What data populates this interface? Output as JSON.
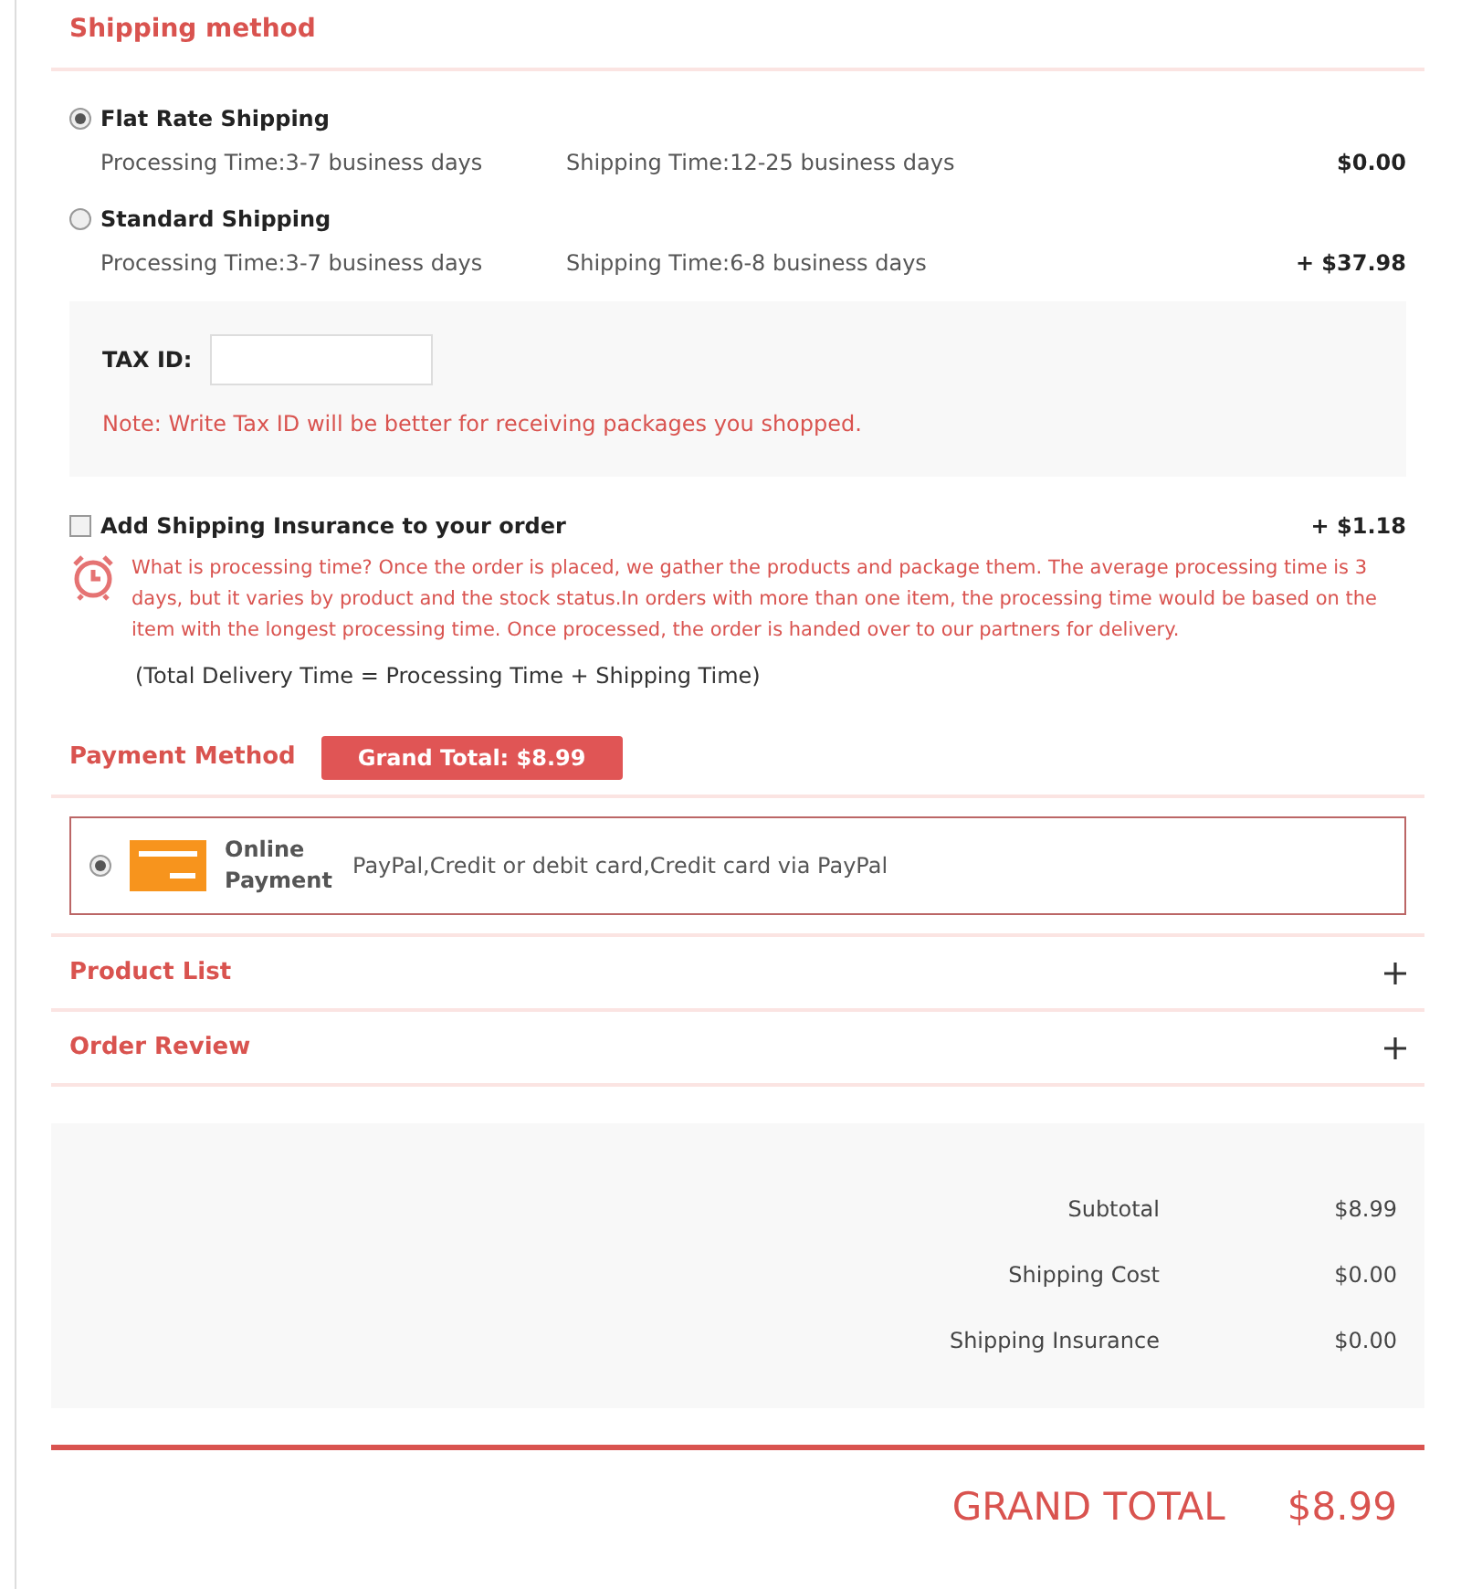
{
  "shipping": {
    "title": "Shipping method",
    "options": [
      {
        "name": "Flat Rate Shipping",
        "selected": true,
        "processing": "Processing Time:3-7 business days",
        "shipping_time": "Shipping Time:12-25 business days",
        "price": "$0.00"
      },
      {
        "name": "Standard Shipping",
        "selected": false,
        "processing": "Processing Time:3-7 business days",
        "shipping_time": "Shipping Time:6-8 business days",
        "price": "+ $37.98"
      }
    ],
    "tax": {
      "label": "TAX ID:",
      "note": "Note: Write Tax ID will be better for receiving packages you shopped."
    },
    "insurance": {
      "label": "Add Shipping Insurance to your order",
      "checked": false,
      "price": "+ $1.18"
    },
    "info": "What is processing time? Once the order is placed, we gather the products and package them. The average processing time is 3 days, but it varies by product and the stock status.In orders with more than one item, the processing time would be based on the item with the longest processing time. Once processed, the order is handed over to our partners for delivery.",
    "formula": "(Total Delivery Time = Processing Time + Shipping Time)"
  },
  "payment": {
    "title": "Payment Method",
    "badge": "Grand Total: $8.99",
    "methods": [
      {
        "name": "Online Payment",
        "selected": true,
        "description": "PayPal,Credit or debit card,Credit card via PayPal"
      }
    ]
  },
  "sections": [
    {
      "title": "Product List",
      "expanded": false
    },
    {
      "title": "Order Review",
      "expanded": false
    }
  ],
  "summary": [
    {
      "label": "Subtotal",
      "value": "$8.99"
    },
    {
      "label": "Shipping Cost",
      "value": "$0.00"
    },
    {
      "label": "Shipping Insurance",
      "value": "$0.00"
    }
  ],
  "grand_total": {
    "label": "GRAND TOTAL",
    "value": "$8.99"
  }
}
